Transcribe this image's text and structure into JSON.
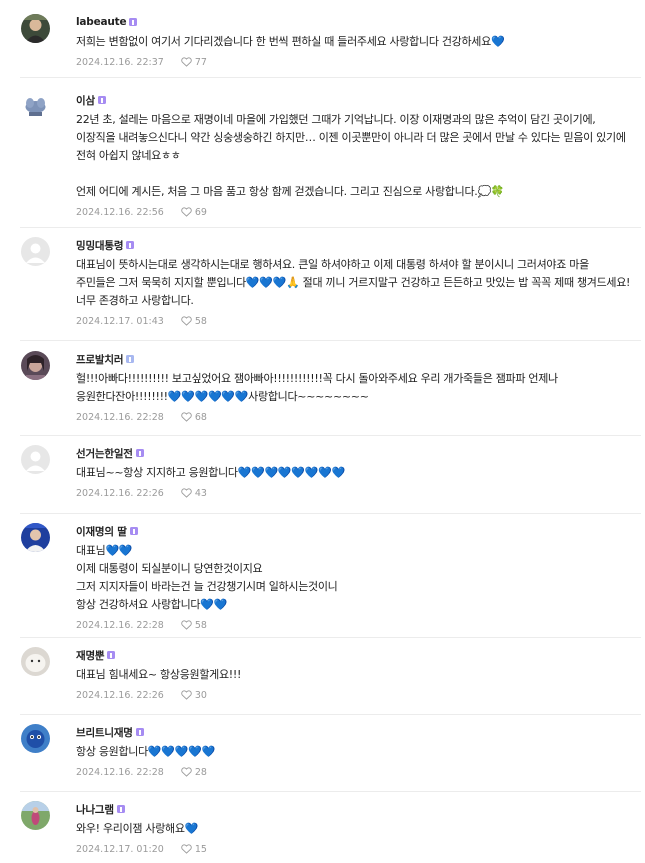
{
  "comments": [
    {
      "nick": "labeaute",
      "badge": "purple",
      "avatar": "face-photo-avatar",
      "text": "저희는 변함없이 여기서 기다리겠습니다 한 번씩 편하실 때 들러주세요 사랑합니다 건강하세요💙",
      "date": "2024.12.16. 22:37",
      "likes": "77"
    },
    {
      "nick": "이삼",
      "badge": "purple",
      "avatar": "plant-avatar",
      "text": "22년 초, 설레는 마음으로 재명이네 마을에 가입했던 그때가 기억납니다. 이장 이재명과의 많은 추억이 담긴 곳이기에, 이장직을 내려놓으신다니 약간 싱숭생숭하긴 하지만… 이젠 이곳뿐만이 아니라 더 많은 곳에서 만날 수 있다는 믿음이 있기에 전혀 아쉽지 않네요ㅎㅎ\n\n언제 어디에 계시든, 처음 그 마음 품고 항상 함께 걷겠습니다. 그리고 진심으로 사랑합니다.💭🍀",
      "date": "2024.12.16. 22:56",
      "likes": "69"
    },
    {
      "nick": "밍밍대통령",
      "badge": "purple",
      "avatar": "default-avatar",
      "text": "대표님이 뜻하시는대로 생각하시는대로 행하셔요. 큰일 하셔야하고 이제 대통령 하셔야 할 분이시니 그러셔야죠 마을 주민들은 그저 묵묵히 지지할 뿐입니다💙💙💙🙏 절대 끼니 거르지말구 건강하고 든든하고 맛있는 밥 꼭꼭 제때 챙겨드세요! 너무 존경하고 사랑합니다.",
      "date": "2024.12.17. 01:43",
      "likes": "58"
    },
    {
      "nick": "프로발치러",
      "badge": "blue",
      "avatar": "portrait-avatar",
      "text": "헐!!!아빠다!!!!!!!!!! 보고싶었어요 잼아빠아!!!!!!!!!!!!꼭 다시 돌아와주세요 우리 개가죽들은 잼파파 언제나 응원한다잔아!!!!!!!!💙💙💙💙💙💙사랑합니다~~~~~~~~",
      "date": "2024.12.16. 22:28",
      "likes": "68"
    },
    {
      "nick": "선거는한일전",
      "badge": "purple",
      "avatar": "default-avatar",
      "text": "대표님~~항상 지지하고 응원합니다💙💙💙💙💙💙💙💙",
      "date": "2024.12.16. 22:26",
      "likes": "43"
    },
    {
      "nick": "이재명의 딸",
      "badge": "purple",
      "avatar": "blue-photo-avatar",
      "text": "대표님💙💙\n이제 대통령이 되실분이니 당연한것이지요\n그저 지지자들이 바라는건 늘 건강챙기시며 일하시는것이니\n항상 건강하셔요 사랑합니다💙💙",
      "date": "2024.12.16. 22:28",
      "likes": "58"
    },
    {
      "nick": "재명뿐",
      "badge": "purple",
      "avatar": "white-animal-avatar",
      "text": "대표님 힘내세요~ 항상응원할게요!!!",
      "date": "2024.12.16. 22:26",
      "likes": "30"
    },
    {
      "nick": "브리트니재명",
      "badge": "purple",
      "avatar": "blue-character-avatar",
      "text": "항상 응원합니다💙💙💙💙💙",
      "date": "2024.12.16. 22:28",
      "likes": "28"
    },
    {
      "nick": "나나그램",
      "badge": "purple",
      "avatar": "outdoor-photo-avatar",
      "text": "와우! 우리이잼 사랑해요💙",
      "date": "2024.12.17. 01:20",
      "likes": "15"
    }
  ],
  "colors": {
    "badge_purple": "#a68cf2",
    "badge_blue": "#a8b8f0",
    "meta_gray": "#9a9a9a",
    "divider": "#ececec"
  }
}
